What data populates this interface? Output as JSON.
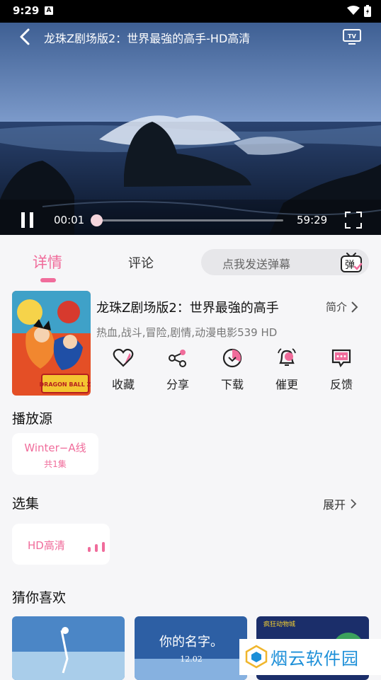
{
  "status": {
    "time": "9:29",
    "notif_letter": "A"
  },
  "player": {
    "title": "龙珠Z剧场版2：世界最強的高手-HD高清",
    "current_time": "00:01",
    "total_time": "59:29",
    "progress_fraction": 0.0003
  },
  "tabs": {
    "detail": "详情",
    "comment": "评论"
  },
  "danmaku": {
    "placeholder": "点我发送弹幕",
    "icon_char": "弹"
  },
  "info": {
    "title": "龙珠Z剧场版2：世界最強的高手",
    "intro_label": "简介",
    "tags": "热血,战斗,冒险,剧情,动漫电影539 HD",
    "poster_text": "DRAGON BALL Z"
  },
  "actions": [
    {
      "label": "收藏",
      "icon": "heart-icon"
    },
    {
      "label": "分享",
      "icon": "share-icon"
    },
    {
      "label": "下载",
      "icon": "download-icon"
    },
    {
      "label": "催更",
      "icon": "bell-icon"
    },
    {
      "label": "反馈",
      "icon": "feedback-icon"
    }
  ],
  "source": {
    "title": "播放源",
    "name": "Winter−A线",
    "count": "共1集"
  },
  "episodes": {
    "title": "选集",
    "expand_label": "展开",
    "items": [
      {
        "label": "HD高清"
      }
    ]
  },
  "recommend": {
    "title": "猜你喜欢",
    "items": [
      {
        "overlay": ""
      },
      {
        "overlay": "你的名字。",
        "date": "12.02"
      },
      {
        "overlay": "疯狂动物城"
      }
    ]
  },
  "watermark": {
    "text": "烟云软件园"
  },
  "colors": {
    "accent": "#f06c9b",
    "watermark": "#1c8fd8"
  }
}
